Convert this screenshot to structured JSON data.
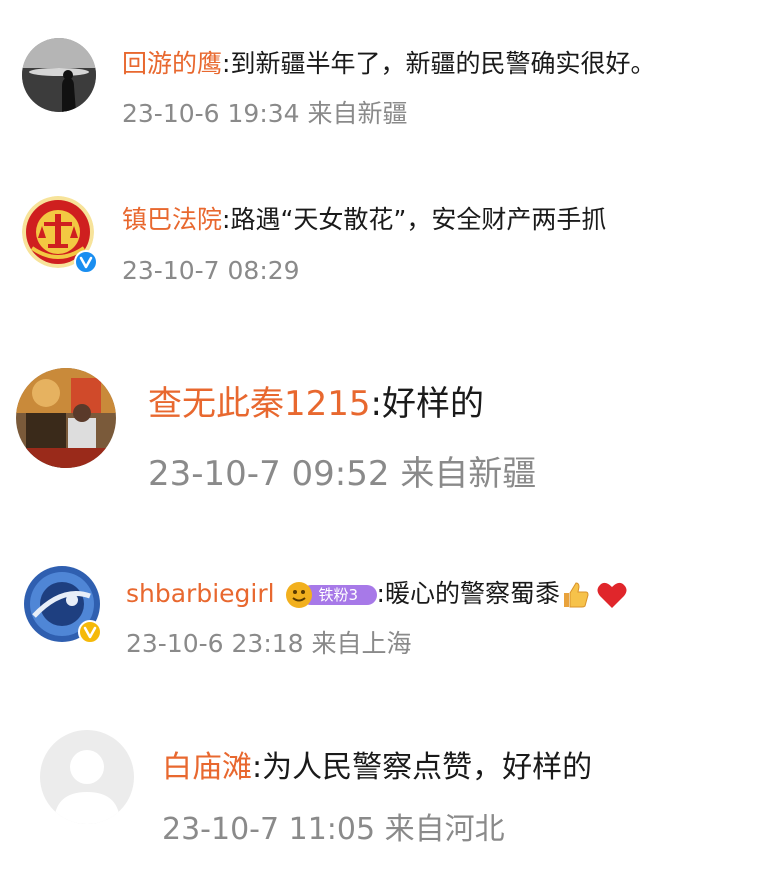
{
  "comments": [
    {
      "username": "回游的鹰",
      "sep": ":",
      "text": "到新疆半年了，新疆的民警确实很好。",
      "time": "23-10-6 19:34",
      "location": "来自新疆",
      "verified": false
    },
    {
      "username": "镇巴法院",
      "sep": ":",
      "text": "路遇“天女散花”，安全财产两手抓",
      "time": "23-10-7 08:29",
      "location": "",
      "verified": true,
      "verified_color": "#1a8ef0"
    },
    {
      "username": "查无此秦1215",
      "sep": ":",
      "text": "好样的",
      "time": "23-10-7 09:52",
      "location": "来自新疆",
      "verified": false
    },
    {
      "username": "shbarbiegirl",
      "sep": ":",
      "badge_text": "铁粉3",
      "text": "暖心的警察蜀黍",
      "emoji": [
        "thumbs-up",
        "red-heart"
      ],
      "time": "23-10-6 23:18",
      "location": "来自上海",
      "verified": true,
      "verified_color": "#f5b90a"
    },
    {
      "username": "白庙滩",
      "sep": ":",
      "text": "为人民警察点赞，好样的",
      "time": "23-10-7 11:05",
      "location": "来自河北",
      "verified": false
    }
  ],
  "colors": {
    "username": "#e8682f",
    "meta": "#8a8a8a",
    "text": "#1a1a1a",
    "heart": "#e0262b"
  }
}
